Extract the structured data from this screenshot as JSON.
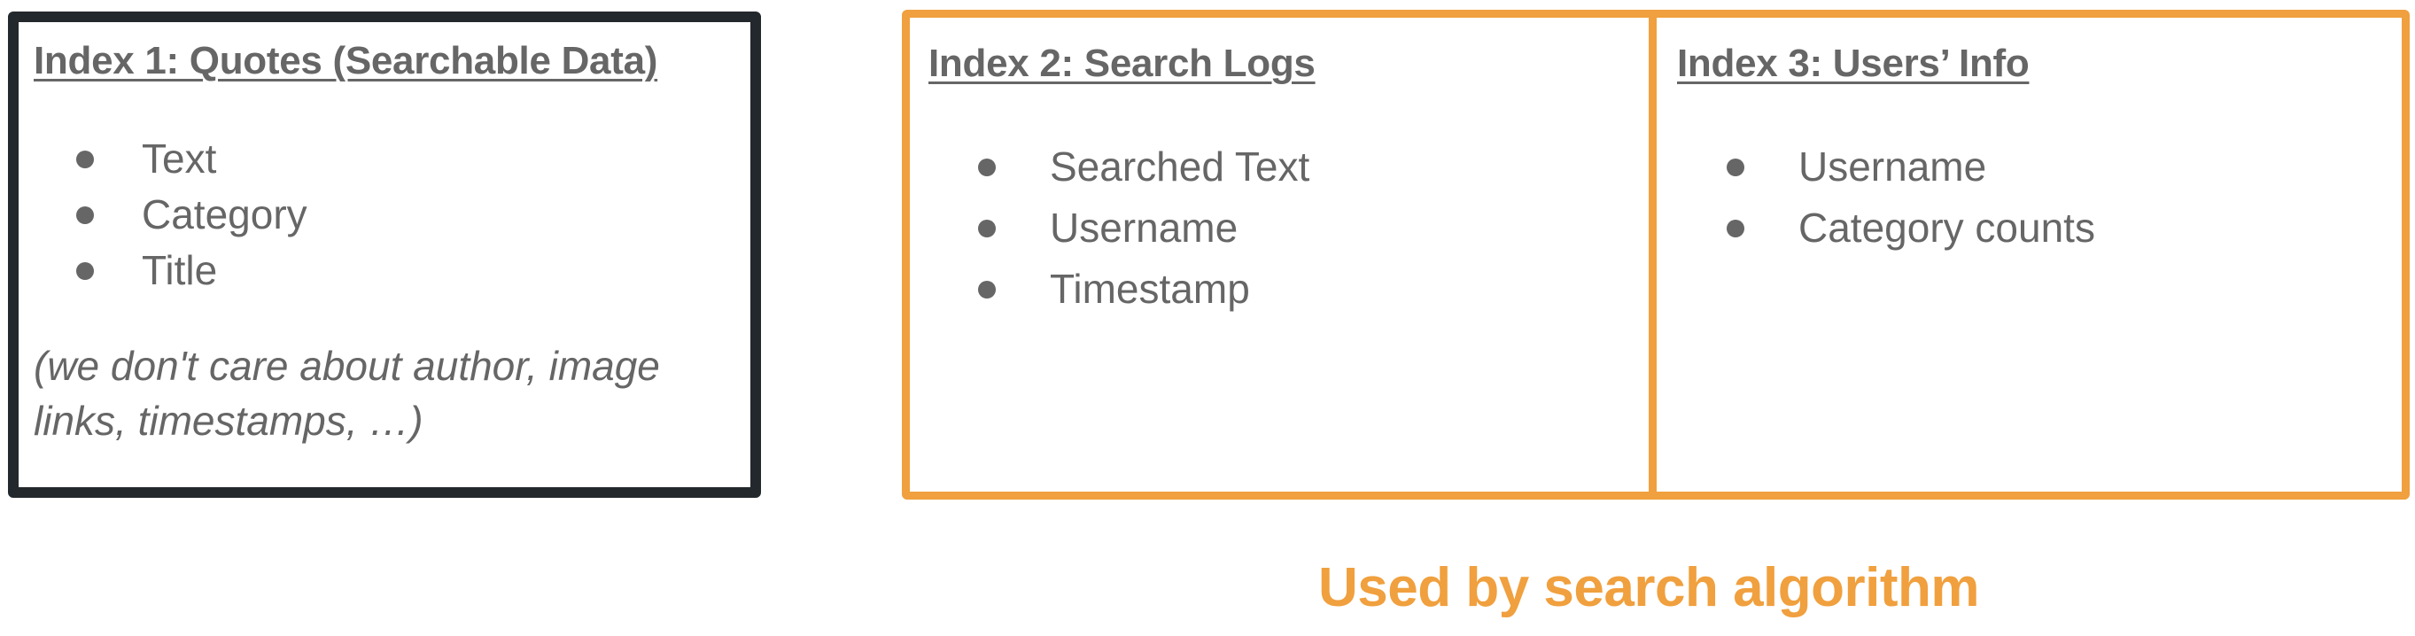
{
  "colors": {
    "index1_border": "#23282d",
    "used_by_search_border": "#f0a03e",
    "text": "#666666",
    "caption": "#f0a03e"
  },
  "index1": {
    "title": "Index 1: Quotes (Searchable Data)",
    "fields": [
      "Text",
      "Category",
      "Title"
    ],
    "note": "(we don't care about author, image links, timestamps, …)"
  },
  "index2": {
    "title": "Index 2: Search Logs",
    "fields": [
      "Searched Text",
      "Username",
      "Timestamp"
    ]
  },
  "index3": {
    "title": "Index 3: Users’ Info",
    "fields": [
      "Username",
      "Category counts"
    ]
  },
  "caption": "Used by search algorithm"
}
